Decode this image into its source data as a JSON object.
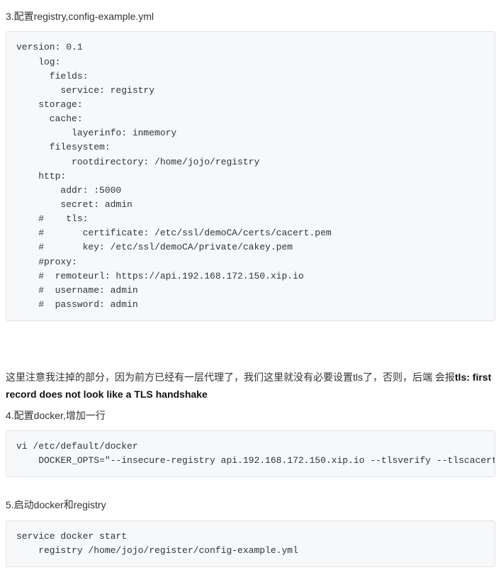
{
  "section3": {
    "title": "3.配置registry,config-example.yml",
    "code": "version: 0.1\n    log:\n      fields:\n        service: registry\n    storage:\n      cache:\n          layerinfo: inmemory\n      filesystem:\n          rootdirectory: /home/jojo/registry\n    http:\n        addr: :5000\n        secret: admin\n    #    tls:\n    #       certificate: /etc/ssl/demoCA/certs/cacert.pem\n    #       key: /etc/ssl/demoCA/private/cakey.pem\n    #proxy:\n    #  remoteurl: https://api.192.168.172.150.xip.io\n    #  username: admin\n    #  password: admin"
  },
  "note": {
    "pre": "这里注意我注掉的部分，因为前方已经有一层代理了，我们这里就没有必要设置tls了，否则，后端 会报",
    "bold": "tls: first record does not look like a TLS handshake"
  },
  "section4": {
    "title": "4.配置docker,增加一行",
    "code": "vi /etc/default/docker\n    DOCKER_OPTS=\"--insecure-registry api.192.168.172.150.xip.io --tlsverify --tlscacert"
  },
  "section5": {
    "title": "5.启动docker和registry",
    "code": "service docker start\n    registry /home/jojo/register/config-example.yml"
  }
}
